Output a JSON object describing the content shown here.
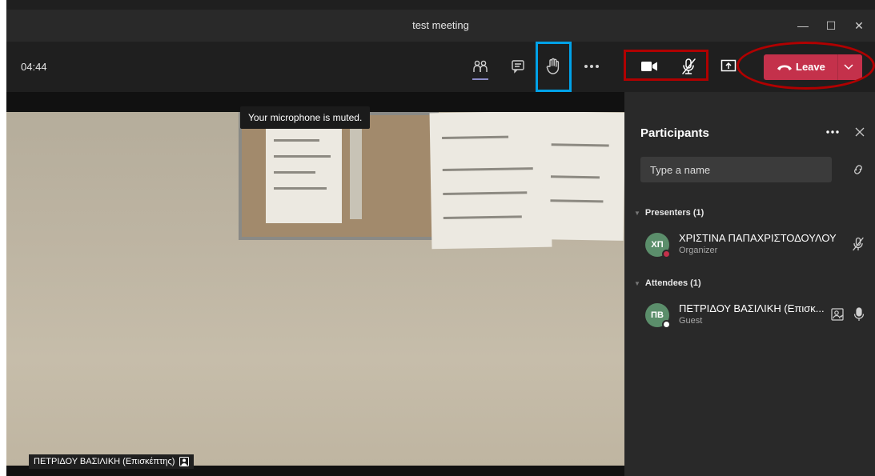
{
  "window": {
    "title": "test meeting",
    "minimize_glyph": "—",
    "maximize_glyph": "☐",
    "close_glyph": "✕"
  },
  "toolbar": {
    "timer": "04:44",
    "buttons": [
      {
        "name": "participants-icon",
        "state": "active"
      },
      {
        "name": "chat-icon"
      },
      {
        "name": "raise-hand-icon",
        "highlight": "blue"
      },
      {
        "name": "more-actions-icon"
      },
      {
        "name": "camera-icon",
        "highlight": "red"
      },
      {
        "name": "microphone-muted-icon",
        "highlight": "red"
      },
      {
        "name": "share-screen-icon"
      }
    ],
    "leave_label": "Leave",
    "leave_color": "#c4314b"
  },
  "video": {
    "toast": "Your microphone is muted.",
    "name_tag": "ΠΕΤΡΙΔΟΥ ΒΑΣΙΛΙΚΗ (Επισκέπτης)"
  },
  "participants": {
    "title": "Participants",
    "search_placeholder": "Type a name",
    "sections": [
      {
        "label": "Presenters (1)",
        "people": [
          {
            "initials": "ΧΠ",
            "name": "ΧΡΙΣΤΙΝΑ ΠΑΠΑΧΡΙΣΤΟΔΟΥΛΟΥ",
            "role": "Organizer",
            "presence_color": "#c4314b",
            "mic": "muted"
          }
        ]
      },
      {
        "label": "Attendees (1)",
        "people": [
          {
            "initials": "ΠΒ",
            "name": "ΠΕΤΡΙΔΟΥ ΒΑΣΙΛΙΚΗ (Επισκ...",
            "role": "Guest",
            "presence_color": "#ffffff",
            "mic": "on"
          }
        ]
      }
    ]
  },
  "colors": {
    "accent": "#8b8cc7",
    "highlight_blue": "#00a2e8",
    "highlight_red": "#b00000"
  }
}
